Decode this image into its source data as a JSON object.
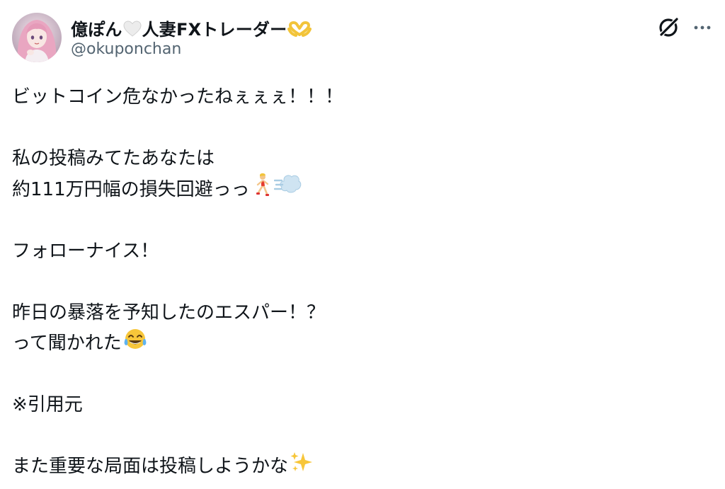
{
  "author": {
    "name_part1": "億ぽん",
    "name_part2": "人妻FXトレーダー",
    "handle": "@okuponchan",
    "heart_white_icon": "white-heart-emoji",
    "heart_gold_icon": "heart-hands-emoji"
  },
  "actions": {
    "grok_icon": "grok-icon",
    "more_icon": "more-icon"
  },
  "tweet": {
    "line1": "ビットコイン危なかったねぇぇぇ！！！",
    "line2": "私の投稿みてたあなたは",
    "line3": "約111万円幅の損失回避っっ",
    "line3_emoji": "running-person-emoji dash-emoji",
    "line4": "フォローナイス！",
    "line5": "昨日の暴落を予知したのエスパー！？",
    "line6": "って聞かれた",
    "line6_emoji": "tears-of-joy-emoji",
    "line7": "※引用元",
    "line8": "また重要な局面は投稿しようかな",
    "line8_emoji": "sparkles-emoji"
  },
  "colors": {
    "text": "#0f1419",
    "secondary": "#536471",
    "avatar_pink": "#e9a6c1"
  }
}
